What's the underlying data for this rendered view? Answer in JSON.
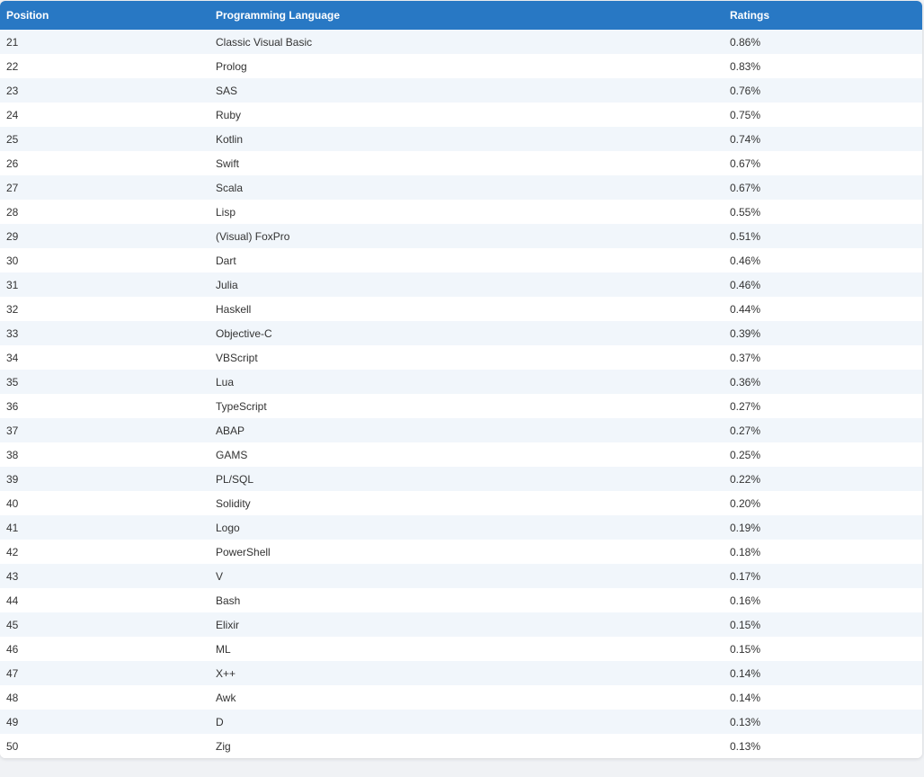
{
  "table": {
    "headers": [
      "Position",
      "Programming Language",
      "Ratings"
    ],
    "rows": [
      [
        "21",
        "Classic Visual Basic",
        "0.86%"
      ],
      [
        "22",
        "Prolog",
        "0.83%"
      ],
      [
        "23",
        "SAS",
        "0.76%"
      ],
      [
        "24",
        "Ruby",
        "0.75%"
      ],
      [
        "25",
        "Kotlin",
        "0.74%"
      ],
      [
        "26",
        "Swift",
        "0.67%"
      ],
      [
        "27",
        "Scala",
        "0.67%"
      ],
      [
        "28",
        "Lisp",
        "0.55%"
      ],
      [
        "29",
        "(Visual) FoxPro",
        "0.51%"
      ],
      [
        "30",
        "Dart",
        "0.46%"
      ],
      [
        "31",
        "Julia",
        "0.46%"
      ],
      [
        "32",
        "Haskell",
        "0.44%"
      ],
      [
        "33",
        "Objective-C",
        "0.39%"
      ],
      [
        "34",
        "VBScript",
        "0.37%"
      ],
      [
        "35",
        "Lua",
        "0.36%"
      ],
      [
        "36",
        "TypeScript",
        "0.27%"
      ],
      [
        "37",
        "ABAP",
        "0.27%"
      ],
      [
        "38",
        "GAMS",
        "0.25%"
      ],
      [
        "39",
        "PL/SQL",
        "0.22%"
      ],
      [
        "40",
        "Solidity",
        "0.20%"
      ],
      [
        "41",
        "Logo",
        "0.19%"
      ],
      [
        "42",
        "PowerShell",
        "0.18%"
      ],
      [
        "43",
        "V",
        "0.17%"
      ],
      [
        "44",
        "Bash",
        "0.16%"
      ],
      [
        "45",
        "Elixir",
        "0.15%"
      ],
      [
        "46",
        "ML",
        "0.15%"
      ],
      [
        "47",
        "X++",
        "0.14%"
      ],
      [
        "48",
        "Awk",
        "0.14%"
      ],
      [
        "49",
        "D",
        "0.13%"
      ],
      [
        "50",
        "Zig",
        "0.13%"
      ]
    ]
  },
  "colors": {
    "header_bg": "#2878c4",
    "header_text": "#ffffff",
    "row_alt_bg": "#f1f6fb",
    "row_bg": "#ffffff",
    "text": "#333333"
  }
}
